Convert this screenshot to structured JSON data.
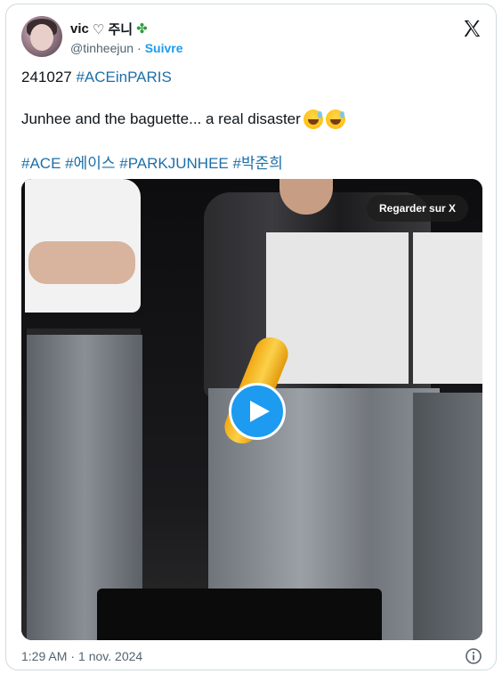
{
  "author": {
    "display_name": "vic",
    "name_extra": "♡ 주니",
    "clover_icon": "four-leaf-clover-icon",
    "handle": "@tinheejun",
    "separator": "·",
    "follow_label": "Suivre"
  },
  "post": {
    "line1_text": "241027 ",
    "line1_tag": "#ACEinPARIS",
    "line2_text": "Junhee and the baguette... a real disaster ",
    "line2_emojis": [
      "grinning-sweat-emoji",
      "grinning-sweat-emoji"
    ],
    "hashtags": [
      "#ACE",
      "#에이스",
      "#PARKJUNHEE",
      "#박준희"
    ]
  },
  "media": {
    "watch_on_x_label": "Regarder sur X",
    "play_icon": "play-icon"
  },
  "footer": {
    "time": "1:29 AM",
    "separator": "·",
    "date": "1 nov. 2024",
    "info_icon": "info-icon"
  },
  "colors": {
    "link": "#1d9bf0",
    "hashtag": "#1d6fa8",
    "muted": "#536471",
    "border": "#cfd9de"
  }
}
